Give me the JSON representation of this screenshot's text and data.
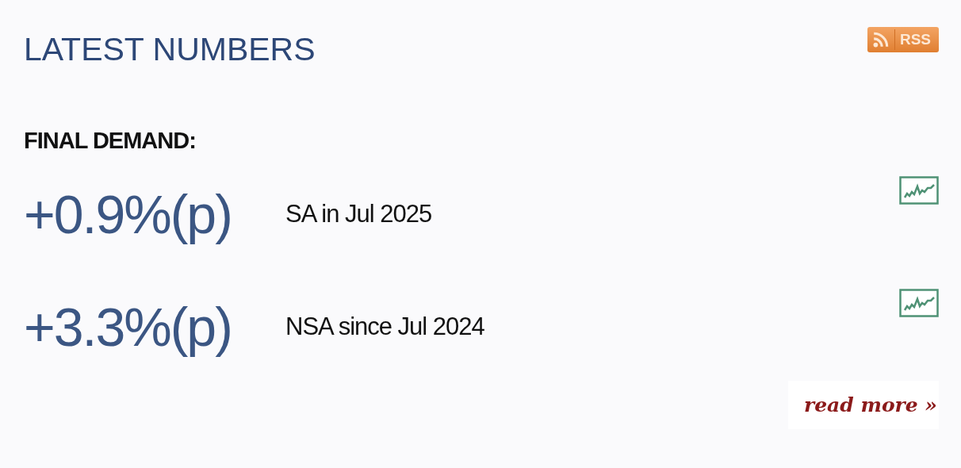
{
  "title": "LATEST NUMBERS",
  "rss": {
    "label": "RSS"
  },
  "section": "FINAL DEMAND:",
  "stats": [
    {
      "value": "+0.9%(p)",
      "description": "SA in Jul 2025"
    },
    {
      "value": "+3.3%(p)",
      "description": "NSA since Jul 2024"
    }
  ],
  "read_more": "read more »"
}
